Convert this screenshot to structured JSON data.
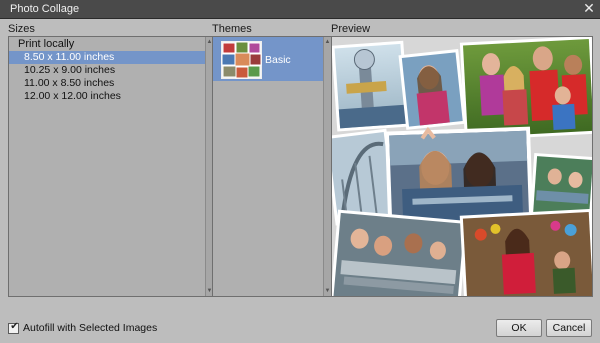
{
  "window": {
    "title": "Photo Collage",
    "close_glyph": "✕"
  },
  "sizes": {
    "label": "Sizes",
    "group": "Print locally",
    "items": [
      {
        "label": "8.50 x 11.00 inches",
        "selected": true
      },
      {
        "label": "10.25 x 9.00 inches",
        "selected": false
      },
      {
        "label": "11.00 x 8.50 inches",
        "selected": false
      },
      {
        "label": "12.00 x 12.00 inches",
        "selected": false
      }
    ]
  },
  "themes": {
    "label": "Themes",
    "items": [
      {
        "name": "Basic",
        "selected": true
      }
    ]
  },
  "preview": {
    "label": "Preview"
  },
  "footer": {
    "autofill_label": "Autofill with Selected Images",
    "autofill_checked": true,
    "ok_label": "OK",
    "cancel_label": "Cancel"
  },
  "colors": {
    "selection": "#7495c9",
    "titlebar": "#4a4a4a",
    "dialog_bg": "#bdbdbd"
  }
}
